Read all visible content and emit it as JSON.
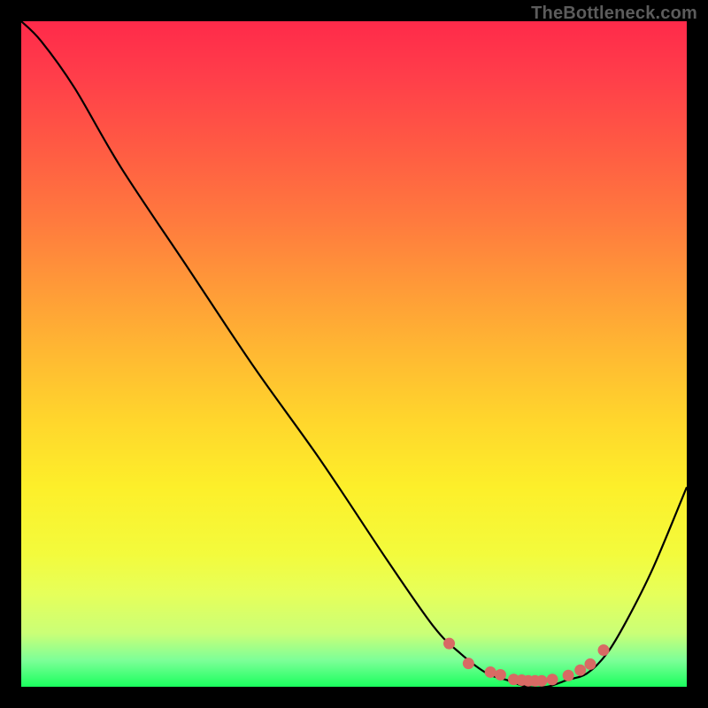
{
  "watermark": "TheBottleneck.com",
  "colors": {
    "frame_border": "#000000",
    "curve_stroke": "#000000",
    "marker_fill": "#d86a64",
    "gradient_stops": [
      "#ff2a4a",
      "#ff3d4a",
      "#ff5844",
      "#ff7a3e",
      "#ff9a38",
      "#ffb932",
      "#ffd62c",
      "#fdef2a",
      "#f3fb3c",
      "#e6ff5a",
      "#caff77",
      "#7dff98",
      "#1aff5e"
    ]
  },
  "chart_data": {
    "type": "line",
    "title": "",
    "xlabel": "",
    "ylabel": "",
    "xlim": [
      0,
      1
    ],
    "ylim": [
      0,
      1
    ],
    "x": [
      0.0,
      0.03,
      0.08,
      0.15,
      0.25,
      0.35,
      0.45,
      0.55,
      0.62,
      0.66,
      0.7,
      0.73,
      0.76,
      0.79,
      0.82,
      0.85,
      0.88,
      0.91,
      0.95,
      1.0
    ],
    "y": [
      1.0,
      0.97,
      0.9,
      0.78,
      0.63,
      0.48,
      0.34,
      0.19,
      0.09,
      0.05,
      0.02,
      0.01,
      0.0,
      0.0,
      0.01,
      0.02,
      0.05,
      0.1,
      0.18,
      0.3
    ],
    "annotations": {
      "markers": [
        {
          "x": 0.643,
          "y": 0.065
        },
        {
          "x": 0.672,
          "y": 0.035
        },
        {
          "x": 0.705,
          "y": 0.022
        },
        {
          "x": 0.72,
          "y": 0.018
        },
        {
          "x": 0.74,
          "y": 0.011
        },
        {
          "x": 0.752,
          "y": 0.01
        },
        {
          "x": 0.762,
          "y": 0.009
        },
        {
          "x": 0.772,
          "y": 0.009
        },
        {
          "x": 0.782,
          "y": 0.009
        },
        {
          "x": 0.798,
          "y": 0.011
        },
        {
          "x": 0.822,
          "y": 0.017
        },
        {
          "x": 0.84,
          "y": 0.025
        },
        {
          "x": 0.855,
          "y": 0.034
        },
        {
          "x": 0.875,
          "y": 0.055
        }
      ]
    }
  }
}
